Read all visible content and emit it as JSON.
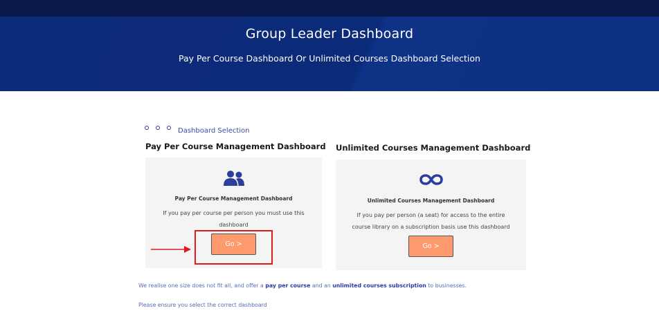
{
  "hero": {
    "title": "Group Leader Dashboard",
    "subtitle": "Pay Per Course Dashboard Or Unlimited Courses Dashboard Selection"
  },
  "section": {
    "label": "Dashboard Selection"
  },
  "pay_per_course": {
    "heading": "Pay Per Course Management Dashboard",
    "icon": "users-icon",
    "card_title": "Pay Per Course Management Dashboard",
    "description": "If you pay per course per person you must use this dashboard",
    "button_label": "Go >"
  },
  "unlimited": {
    "heading": "Unlimited Courses Management Dashboard",
    "icon": "infinity-icon",
    "card_title": "Unlimited Courses Management Dashboard",
    "description": "If you pay per person (a seat) for access to the entire course library on a subscription basis use this dashboard",
    "button_label": "Go >"
  },
  "footer": {
    "line1_prefix": "We realise one size does not fit all, and offer a ",
    "line1_bold1": "pay per course",
    "line1_mid": " and an ",
    "line1_bold2": "unlimited courses subscription",
    "line1_suffix": " to businesses.",
    "line2": "Please ensure you select the correct dashboard"
  },
  "colors": {
    "hero_bg": "#0c2a7a",
    "accent": "#2c3e9c",
    "button": "#fd9b6f",
    "highlight": "#e01b1b"
  }
}
